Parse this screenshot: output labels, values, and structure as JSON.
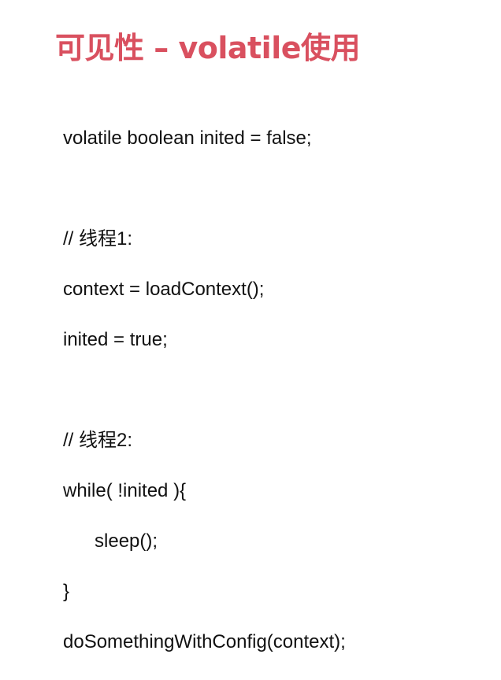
{
  "title": "可见性 – volatile使用",
  "code_lines": [
    "volatile boolean inited = false;",
    "",
    "// 线程1:",
    "context = loadContext();",
    "inited = true;",
    "",
    "// 线程2:",
    "while( !inited ){",
    "      sleep();",
    "}",
    "doSomethingWithConfig(context);"
  ]
}
